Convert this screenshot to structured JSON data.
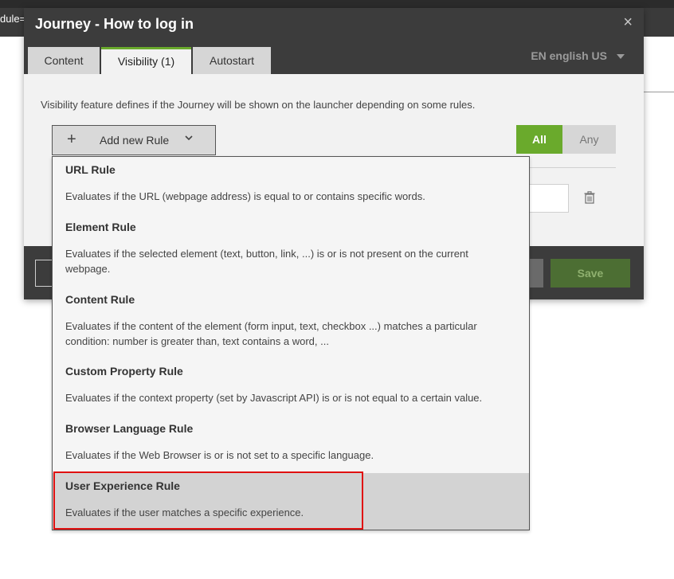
{
  "background": {
    "url_fragment": "dule="
  },
  "modal": {
    "title": "Journey - How to log in",
    "close_glyph": "×",
    "tabs": [
      {
        "label": "Content"
      },
      {
        "label": "Visibility (1)",
        "active": true
      },
      {
        "label": "Autostart"
      }
    ],
    "language": "EN english US",
    "description": "Visibility feature defines if the Journey will be shown on the launcher depending on some rules.",
    "add_rule_label": "Add new Rule",
    "plus_glyph": "+",
    "match_toggle": {
      "all": "All",
      "any": "Any",
      "selected": "All"
    },
    "save_label": "Save"
  },
  "dropdown": {
    "items": [
      {
        "title": "URL Rule",
        "description": "Evaluates if the URL (webpage address) is equal to or contains specific words."
      },
      {
        "title": "Element Rule",
        "description": "Evaluates if the selected element (text, button, link, ...) is or is not present on the current webpage."
      },
      {
        "title": "Content Rule",
        "description": "Evaluates if the content of the element (form input, text, checkbox ...) matches a particular condition: number is greater than, text contains a word, ..."
      },
      {
        "title": "Custom Property Rule",
        "description": "Evaluates if the context property (set by Javascript API) is or is not equal to a certain value."
      },
      {
        "title": "Browser Language Rule",
        "description": "Evaluates if the Web Browser is or is not set to a specific language."
      },
      {
        "title": "User Experience Rule",
        "description": "Evaluates if the user matches a specific experience.",
        "highlighted": true
      }
    ]
  },
  "colors": {
    "accent": "#6aaa2c",
    "header": "#3c3c3c",
    "highlight": "#e01010"
  },
  "icons": {
    "close": "close-icon",
    "plus": "plus-icon",
    "chevron": "chevron-down-icon",
    "trash": "trash-icon",
    "language_caret": "caret-down-icon"
  }
}
